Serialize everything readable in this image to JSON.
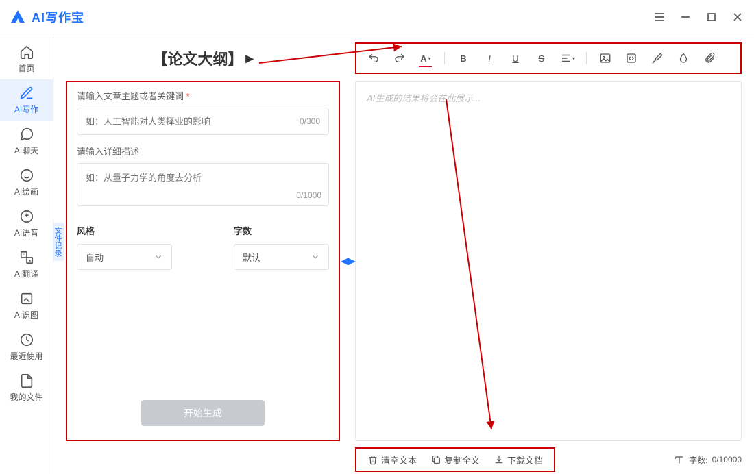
{
  "app": {
    "name": "AI写作宝"
  },
  "sidebar": {
    "fileTab": "文件记录",
    "items": [
      {
        "label": "首页"
      },
      {
        "label": "AI写作"
      },
      {
        "label": "AI聊天"
      },
      {
        "label": "AI绘画"
      },
      {
        "label": "AI语音"
      },
      {
        "label": "AI翻译"
      },
      {
        "label": "AI识图"
      },
      {
        "label": "最近使用"
      },
      {
        "label": "我的文件"
      }
    ]
  },
  "page": {
    "title": "【论文大纲】"
  },
  "form": {
    "topic": {
      "label": "请输入文章主题或者关键词",
      "required": "*",
      "placeholder": "如：人工智能对人类择业的影响",
      "counter": "0/300"
    },
    "desc": {
      "label": "请输入详细描述",
      "placeholder": "如：从量子力学的角度去分析",
      "counter": "0/1000"
    },
    "style": {
      "label": "风格",
      "value": "自动"
    },
    "words": {
      "label": "字数",
      "value": "默认"
    },
    "generate": "开始生成"
  },
  "editor": {
    "placeholder": "AI生成的结果将会在此展示..."
  },
  "actions": {
    "clear": "清空文本",
    "copy": "复制全文",
    "download": "下载文档"
  },
  "wordcount": {
    "label": "字数:",
    "value": "0/10000"
  }
}
